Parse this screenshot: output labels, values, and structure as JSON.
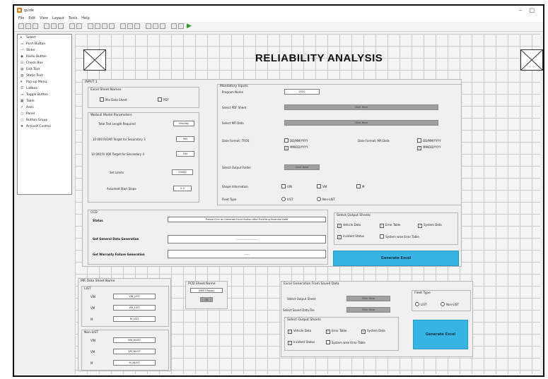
{
  "window": {
    "title": "guide",
    "minimize": "–",
    "maximize": "□"
  },
  "menu": [
    "File",
    "Edit",
    "View",
    "Layout",
    "Tools",
    "Help"
  ],
  "palette": [
    {
      "icon": "▸",
      "label": "Select"
    },
    {
      "icon": "▭",
      "label": "Push Button"
    },
    {
      "icon": "—",
      "label": "Slider"
    },
    {
      "icon": "◉",
      "label": "Radio Button"
    },
    {
      "icon": "☑",
      "label": "Check Box"
    },
    {
      "icon": "▤",
      "label": "Edit Text"
    },
    {
      "icon": "▤",
      "label": "Static Text"
    },
    {
      "icon": "▾",
      "label": "Pop-up Menu"
    },
    {
      "icon": "☰",
      "label": "Listbox"
    },
    {
      "icon": "▭",
      "label": "Toggle Button"
    },
    {
      "icon": "▦",
      "label": "Table"
    },
    {
      "icon": "↗",
      "label": "Axes"
    },
    {
      "icon": "▢",
      "label": "Panel"
    },
    {
      "icon": "▢",
      "label": "Button Group"
    },
    {
      "icon": "❖",
      "label": "ActiveX Control"
    }
  ],
  "app": {
    "title": "RELIABILITY ANALYSIS"
  },
  "input_panel": {
    "title": "INPUT 1"
  },
  "excel_names": {
    "title": "Excel Sheet Names",
    "options": [
      {
        "label": "Mix Data Sheet",
        "checked": false
      },
      {
        "label": "PDF",
        "checked": false
      }
    ]
  },
  "weibull_params": {
    "title": "Weibull Model Parameters",
    "rows": [
      {
        "label": "Total Test Length Required",
        "value": "Hrs/day"
      },
      {
        "label": "10 000 R/OAR Target for Secondary 3",
        "value": "900"
      },
      {
        "label": "10 000 R/ 000 Target for Secondary 4",
        "value": "100"
      },
      {
        "label": "Set Limits",
        "value": "20000"
      },
      {
        "label": "Assumed Start Slope",
        "value": "0.5"
      }
    ]
  },
  "mandatory_inputs": {
    "title": "Mandatory Inputs",
    "program_name_label": "Program Name",
    "program_name_value": "2020",
    "select_pdf_label": "Select PDF Sheet",
    "select_pdf_button": "Click Here",
    "select_mr_label": "Select MR Data",
    "select_mr_button": "Click Here",
    "date_format_label": "Date Format: TROS",
    "date_format_options": [
      {
        "label": "DD/MM/YYYY",
        "checked": false
      },
      {
        "label": "MM/DD/YYYY",
        "checked": true
      }
    ],
    "date_format_mr_label": "Date Format: MR Data",
    "date_format_mr_options": [
      {
        "label": "DD/MM/YYYY",
        "checked": false
      },
      {
        "label": "MM/DD/YYYY",
        "checked": true
      }
    ],
    "select_output_label": "Select Output Folder",
    "select_output_button": "Click Here",
    "shape_info_label": "Shape Information",
    "shape_info_options": [
      {
        "label": "VIN",
        "checked": false
      },
      {
        "label": "VM",
        "checked": false
      },
      {
        "label": "M",
        "checked": false
      }
    ],
    "fleet_type_label": "Fleet Type",
    "fleet_type_options": [
      {
        "label": "LIST",
        "checked": false
      },
      {
        "label": "Non-LIST",
        "checked": false
      }
    ]
  },
  "ccd": {
    "title": "CCD",
    "status_label": "Status",
    "status_value": "Please Click on Generate Excel Button After Providing Essential Data",
    "general_label": "Get General Data Generation",
    "general_value": "-----------------------",
    "failure_label": "Get Warranty Failure Generation",
    "failure_value": "------"
  },
  "select_sheets": {
    "title": "Select Output Sheets",
    "options": [
      {
        "label": "Vehicle Data",
        "checked": true
      },
      {
        "label": "Error Table",
        "checked": true
      },
      {
        "label": "System Data",
        "checked": true
      },
      {
        "label": "Incident Status",
        "checked": true
      },
      {
        "label": "System wise Error Table",
        "checked": false
      }
    ]
  },
  "generate_button": "Generate Excel",
  "mr_data_sheet": {
    "title": "MR Data Sheet Name",
    "list_title": "LIST",
    "list_rows": [
      {
        "label": "VIN",
        "value": "VIN_LIST"
      },
      {
        "label": "VM",
        "value": "VM_LIST"
      },
      {
        "label": "M",
        "value": "M_LIST"
      }
    ],
    "nonlist_title": "Non-LIST",
    "nonlist_rows": [
      {
        "label": "VIN",
        "value": "VIN_NLIST"
      },
      {
        "label": "VM",
        "value": "VM_NLIST"
      },
      {
        "label": "M",
        "value": "M_NLIST"
      }
    ]
  },
  "pcd_sheet": {
    "title": "PCD Sheet Name",
    "value": "SHEET Report",
    "button": "OK"
  },
  "excel_gen": {
    "title": "Excel Generation From Saved Data",
    "select_output_label": "Select Output Sheet",
    "select_output_button": "Click Here",
    "select_saved_label": "Select Saved Data File",
    "select_saved_button": "Click Here",
    "sheets_title": "Select Output Sheets",
    "sheets_options": [
      {
        "label": "Vehicle Data",
        "checked": true
      },
      {
        "label": "Error Table",
        "checked": true
      },
      {
        "label": "System Data",
        "checked": true
      },
      {
        "label": "Incident Status",
        "checked": true
      },
      {
        "label": "System wise Error Table",
        "checked": false
      }
    ],
    "fleet_title": "Fleet Type",
    "fleet_options": [
      {
        "label": "LIST",
        "checked": false
      },
      {
        "label": "Non-LIST",
        "checked": false
      }
    ],
    "generate_button": "Generate Excel"
  },
  "colors": {
    "accent": "#36b5e5",
    "grid": "#c9c9c9",
    "button_gray": "#a0a0a0",
    "run_green": "#2a9d2a"
  }
}
